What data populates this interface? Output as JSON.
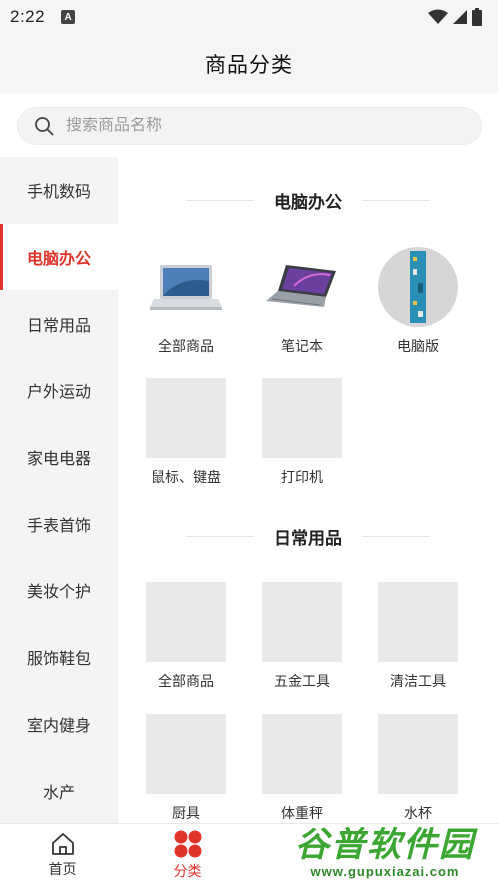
{
  "status_bar": {
    "time": "2:22",
    "notification_badge": "A"
  },
  "header": {
    "title": "商品分类"
  },
  "search": {
    "placeholder": "搜索商品名称",
    "value": ""
  },
  "sidebar": {
    "items": [
      {
        "label": "手机数码",
        "active": false
      },
      {
        "label": "电脑办公",
        "active": true
      },
      {
        "label": "日常用品",
        "active": false
      },
      {
        "label": "户外运动",
        "active": false
      },
      {
        "label": "家电电器",
        "active": false
      },
      {
        "label": "手表首饰",
        "active": false
      },
      {
        "label": "美妆个护",
        "active": false
      },
      {
        "label": "服饰鞋包",
        "active": false
      },
      {
        "label": "室内健身",
        "active": false
      },
      {
        "label": "水产",
        "active": false
      }
    ]
  },
  "sections": [
    {
      "title": "电脑办公",
      "items": [
        {
          "label": "全部商品",
          "icon": "laptop-silver-image"
        },
        {
          "label": "笔记本",
          "icon": "laptop-purple-image"
        },
        {
          "label": "电脑版",
          "icon": "circuit-board-image"
        },
        {
          "label": "鼠标、键盘",
          "icon": "placeholder-image"
        },
        {
          "label": "打印机",
          "icon": "placeholder-image"
        }
      ]
    },
    {
      "title": "日常用品",
      "items": [
        {
          "label": "全部商品",
          "icon": "placeholder-image"
        },
        {
          "label": "五金工具",
          "icon": "placeholder-image"
        },
        {
          "label": "清洁工具",
          "icon": "placeholder-image"
        },
        {
          "label": "厨具",
          "icon": "placeholder-image"
        },
        {
          "label": "体重秤",
          "icon": "placeholder-image"
        },
        {
          "label": "水杯",
          "icon": "placeholder-image"
        }
      ]
    }
  ],
  "tab_bar": {
    "tabs": [
      {
        "label": "首页",
        "icon": "home-icon",
        "active": false
      },
      {
        "label": "分类",
        "icon": "category-icon",
        "active": true
      }
    ]
  },
  "watermark": {
    "text": "谷普软件园",
    "url": "www.gupuxiazai.com"
  },
  "colors": {
    "accent": "#e0332a",
    "sidebar_bg": "#f4f4f4",
    "header_bg": "#f5f5f5",
    "watermark": "#3ca632"
  }
}
